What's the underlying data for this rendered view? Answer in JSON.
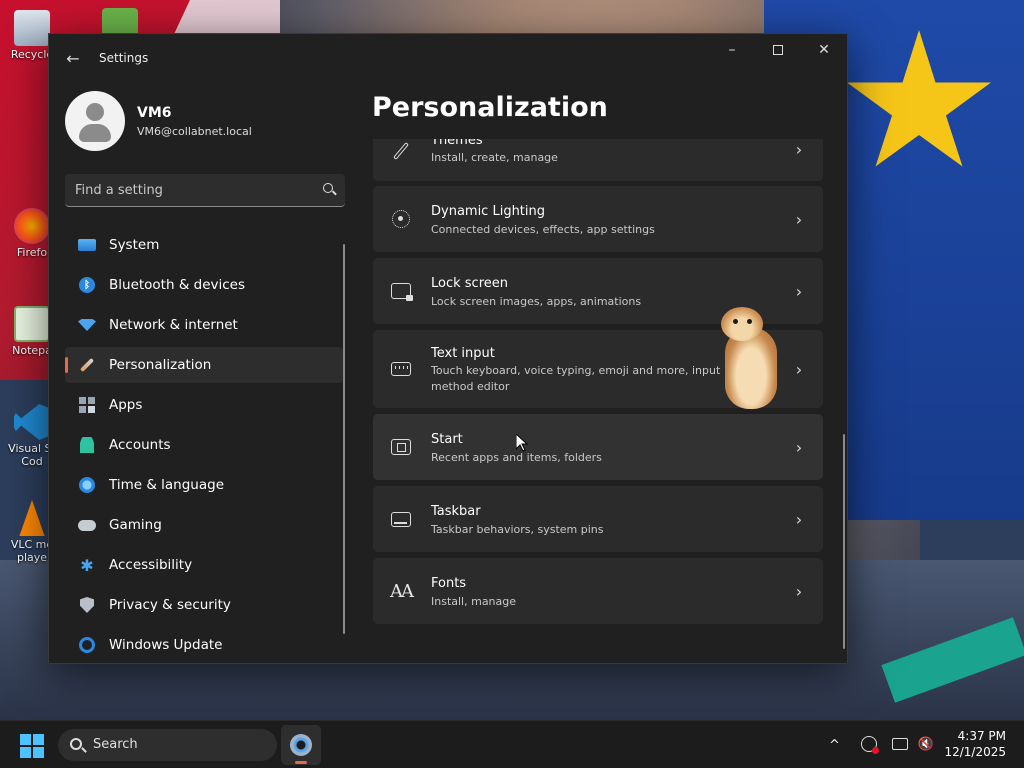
{
  "desktop": {
    "icons": [
      {
        "label": "Recycle"
      },
      {
        "label": ""
      },
      {
        "label": "Firefo"
      },
      {
        "label": "Notepa"
      },
      {
        "label": "Visual St Cod"
      },
      {
        "label": "VLC me playe"
      }
    ]
  },
  "window": {
    "title": "Settings",
    "controls": {
      "minimize": "–",
      "close": "✕"
    }
  },
  "profile": {
    "name": "VM6",
    "email": "VM6@collabnet.local"
  },
  "search": {
    "placeholder": "Find a setting"
  },
  "nav": {
    "items": [
      {
        "label": "System",
        "icon": "system-icon"
      },
      {
        "label": "Bluetooth & devices",
        "icon": "bluetooth-icon"
      },
      {
        "label": "Network & internet",
        "icon": "wifi-icon"
      },
      {
        "label": "Personalization",
        "icon": "paintbrush-icon",
        "selected": true
      },
      {
        "label": "Apps",
        "icon": "apps-icon"
      },
      {
        "label": "Accounts",
        "icon": "person-icon"
      },
      {
        "label": "Time & language",
        "icon": "globe-clock-icon"
      },
      {
        "label": "Gaming",
        "icon": "gamepad-icon"
      },
      {
        "label": "Accessibility",
        "icon": "accessibility-icon"
      },
      {
        "label": "Privacy & security",
        "icon": "shield-icon"
      },
      {
        "label": "Windows Update",
        "icon": "update-icon"
      }
    ]
  },
  "page": {
    "title": "Personalization",
    "cards": [
      {
        "title": "Themes",
        "subtitle": "Install, create, manage",
        "icon": "brush-icon"
      },
      {
        "title": "Dynamic Lighting",
        "subtitle": "Connected devices, effects, app settings",
        "icon": "lighting-icon"
      },
      {
        "title": "Lock screen",
        "subtitle": "Lock screen images, apps, animations",
        "icon": "lock-screen-icon"
      },
      {
        "title": "Text input",
        "subtitle": "Touch keyboard, voice typing, emoji and more, input method editor",
        "icon": "keyboard-icon"
      },
      {
        "title": "Start",
        "subtitle": "Recent apps and items, folders",
        "icon": "start-icon"
      },
      {
        "title": "Taskbar",
        "subtitle": "Taskbar behaviors, system pins",
        "icon": "taskbar-icon"
      },
      {
        "title": "Fonts",
        "subtitle": "Install, manage",
        "icon": "fonts-icon",
        "glyph": "AA"
      }
    ],
    "chevron": "›"
  },
  "taskbar": {
    "search_label": "Search",
    "tray_chevron": "^",
    "time": "4:37 PM",
    "date": "12/1/2025",
    "volume_glyph": "🔇"
  },
  "colors": {
    "accent": "#e8674d",
    "window_bg": "#202020",
    "card_bg": "#2b2b2b",
    "taskbar_bg": "#1c1c1c",
    "start_blue": "#4cc2ff"
  }
}
